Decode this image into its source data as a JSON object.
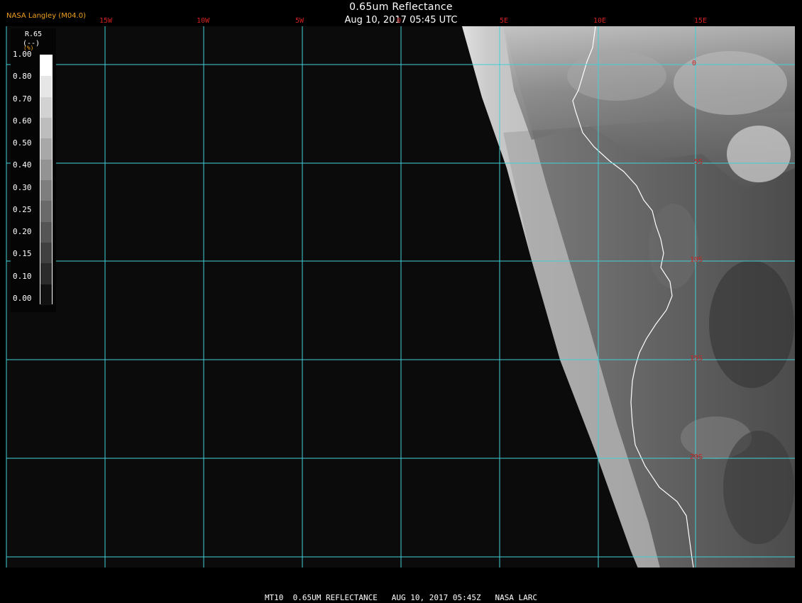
{
  "header": {
    "credit": "NASA Langley (M04.0)",
    "title": "0.65um Reflectance",
    "datetime": "Aug 10, 2017 05:45 UTC"
  },
  "footer": {
    "caption": "MT10  0.65UM REFLECTANCE   AUG 10, 2017 05:45Z   NASA LARC"
  },
  "legend": {
    "variable": "R.65",
    "units": "(--)",
    "units_prefix": "(%)",
    "ticks": [
      "1.00",
      "0.80",
      "0.70",
      "0.60",
      "0.50",
      "0.40",
      "0.30",
      "0.25",
      "0.20",
      "0.15",
      "0.10",
      "0.00"
    ],
    "colors": [
      "#ffffff",
      "#e6e6e6",
      "#d2d2d2",
      "#bdbdbd",
      "#a8a8a8",
      "#939393",
      "#7e7e7e",
      "#6a6a6a",
      "#555555",
      "#404040",
      "#2b2b2b",
      "#111111"
    ]
  },
  "grid": {
    "line_color": "#40d0d8",
    "label_color": "#d02020",
    "lon_labels": [
      "15W",
      "10W",
      "5W",
      "0",
      "5E",
      "10E",
      "15E"
    ],
    "lat_labels": [
      "0",
      "5S",
      "10S",
      "15S",
      "20S"
    ]
  },
  "map": {
    "background": "#0b0b0b",
    "land_coast_color": "#ffffff"
  }
}
